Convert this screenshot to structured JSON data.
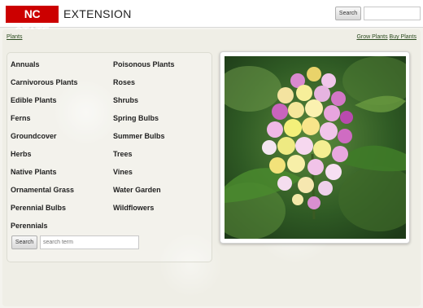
{
  "header": {
    "logo_mark": "NC STATE",
    "logo_text": "EXTENSION",
    "search_button": "Search",
    "search_value": ""
  },
  "breadcrumb": "Plants",
  "top_links": [
    "Grow Plants",
    "Buy Plants"
  ],
  "categories": {
    "column1": [
      "Annuals",
      "Carnivorous Plants",
      "Edible Plants",
      "Ferns",
      "Groundcover",
      "Herbs",
      "Native Plants",
      "Ornamental Grass",
      "Perennial Bulbs",
      "Perennials"
    ],
    "column2": [
      "Poisonous Plants",
      "Roses",
      "Shrubs",
      "Spring Bulbs",
      "Summer Bulbs",
      "Trees",
      "Vines",
      "Water Garden",
      "Wildflowers"
    ]
  },
  "list_search": {
    "button": "Search",
    "placeholder": "search term",
    "value": ""
  },
  "colors": {
    "brand_red": "#cc0000",
    "link_green": "#2a4a1e"
  }
}
